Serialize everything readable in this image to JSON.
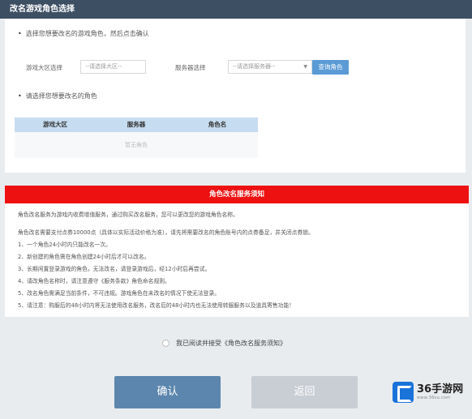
{
  "header": {
    "title": "改名游戏角色选择"
  },
  "step1": {
    "instruction": "选择您想要改名的游戏角色，然后点击确认",
    "region_label": "游戏大区选择",
    "region_placeholder": "--请选择大区--",
    "server_label": "服务器选择",
    "server_placeholder": "--请选择服务器--",
    "query_button": "查询角色"
  },
  "step2": {
    "instruction": "请选择您想要改名的角色",
    "columns": [
      "游戏大区",
      "服务器",
      "角色名"
    ],
    "empty_text": "暂无角色"
  },
  "notice": {
    "title": "角色改名服务须知",
    "lines": [
      "角色改名服务为游戏内收费增值服务，通过购买改名服务，您可以更改您的游戏角色名称。",
      "角色改名需要支付点券10000点（具体以实际活动价格为准），请先将需要改名的角色账号内的点券备足，并关闭点券锁。",
      "1、一个角色24小时内只能改名一次。",
      "2、新创建的角色需在角色创建24小时后才可以改名。",
      "3、长期闲置登录游戏的角色，无法改名，请登录游戏后，经12小时后再尝试。",
      "4、请改角色名称时，请注意遵守《服务条款》角色命名规则。",
      "5、改名角色需满足当前条件，不可违规。游戏角色在未改名的情况下使无法登录。",
      "5、请注意：购服后的48小时内将无法使用改名服务，改名后的48小时内也无法使用转服服务以及道具寄售功能！"
    ]
  },
  "agreement": {
    "label": "我已阅读并接受《角色改名服务须知》"
  },
  "actions": {
    "confirm": "确认",
    "back": "返回"
  },
  "logo": {
    "name": "36手游网",
    "url": "www.36su.com"
  }
}
